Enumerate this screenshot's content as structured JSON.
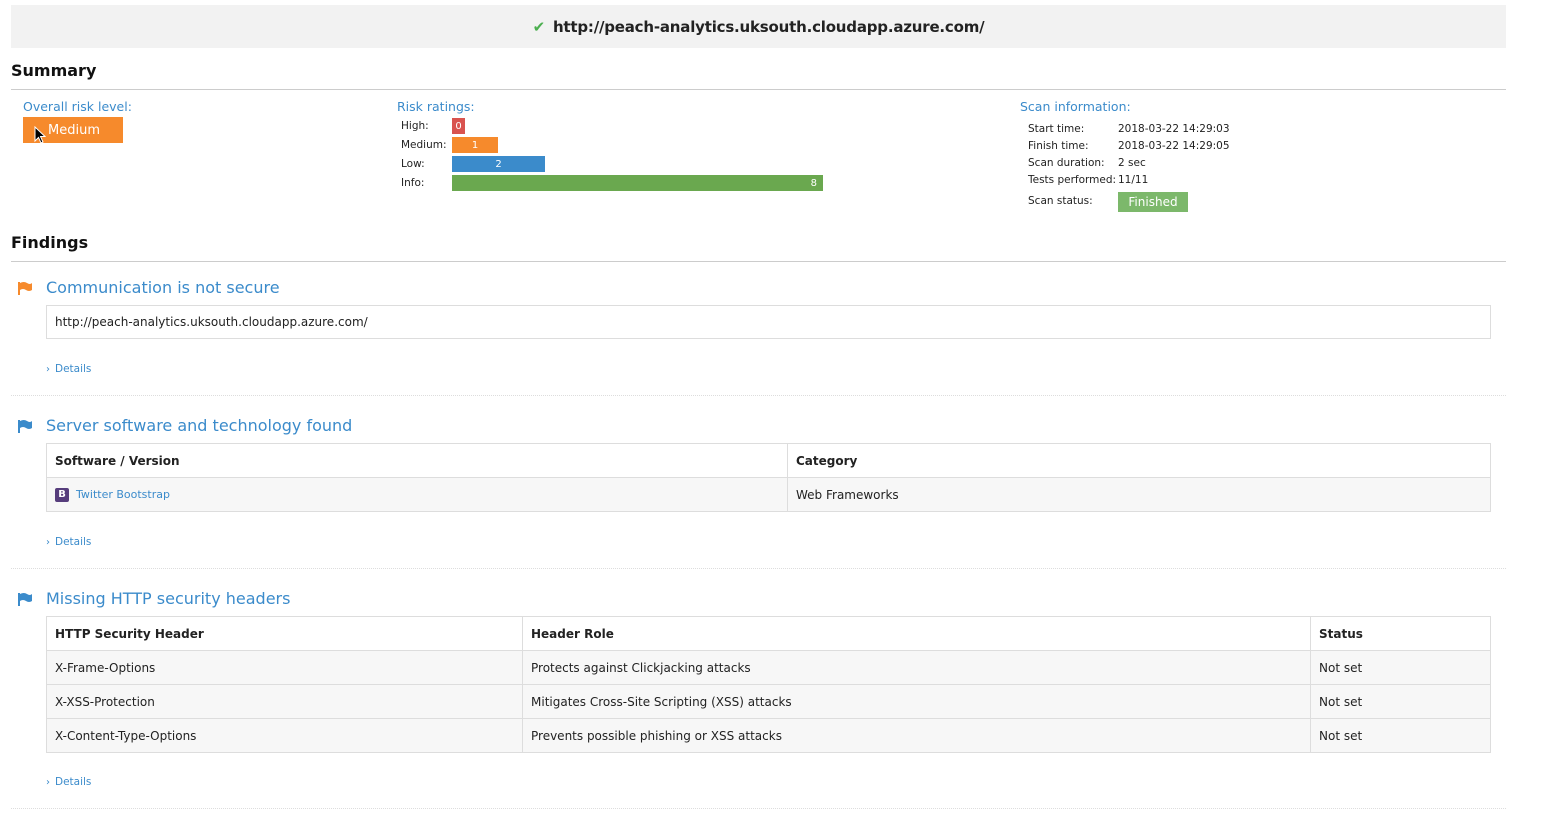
{
  "header": {
    "url": "http://peach-analytics.uksouth.cloudapp.azure.com/"
  },
  "summary": {
    "title": "Summary",
    "overall_risk_label": "Overall risk level:",
    "overall_risk_value": "Medium",
    "risk_ratings_label": "Risk ratings:",
    "ratings": [
      {
        "label": "High:",
        "count": "0",
        "color": "#d9534f"
      },
      {
        "label": "Medium:",
        "count": "1",
        "color": "#f68a2c"
      },
      {
        "label": "Low:",
        "count": "2",
        "color": "#3b8bcb"
      },
      {
        "label": "Info:",
        "count": "8",
        "color": "#6aa84f"
      }
    ],
    "scan_info_label": "Scan information:",
    "scan_info": [
      {
        "label": "Start time:",
        "value": "2018-03-22 14:29:03"
      },
      {
        "label": "Finish time:",
        "value": "2018-03-22 14:29:05"
      },
      {
        "label": "Scan duration:",
        "value": "2 sec"
      },
      {
        "label": "Tests performed:",
        "value": "11/11"
      }
    ],
    "scan_status_label": "Scan status:",
    "scan_status_value": "Finished"
  },
  "findings": {
    "title": "Findings",
    "details_label": "Details",
    "items": [
      {
        "title": "Communication is not secure",
        "flag_color": "#f68a2c",
        "url": "http://peach-analytics.uksouth.cloudapp.azure.com/"
      },
      {
        "title": "Server software and technology found",
        "flag_color": "#3b8bcb",
        "columns": [
          "Software / Version",
          "Category"
        ],
        "rows": [
          {
            "software": "Twitter Bootstrap",
            "category": "Web Frameworks"
          }
        ]
      },
      {
        "title": "Missing HTTP security headers",
        "flag_color": "#3b8bcb",
        "columns": [
          "HTTP Security Header",
          "Header Role",
          "Status"
        ],
        "rows": [
          {
            "header": "X-Frame-Options",
            "role": "Protects against Clickjacking attacks",
            "status": "Not set"
          },
          {
            "header": "X-XSS-Protection",
            "role": "Mitigates Cross-Site Scripting (XSS) attacks",
            "status": "Not set"
          },
          {
            "header": "X-Content-Type-Options",
            "role": "Prevents possible phishing or XSS attacks",
            "status": "Not set"
          }
        ]
      }
    ]
  }
}
